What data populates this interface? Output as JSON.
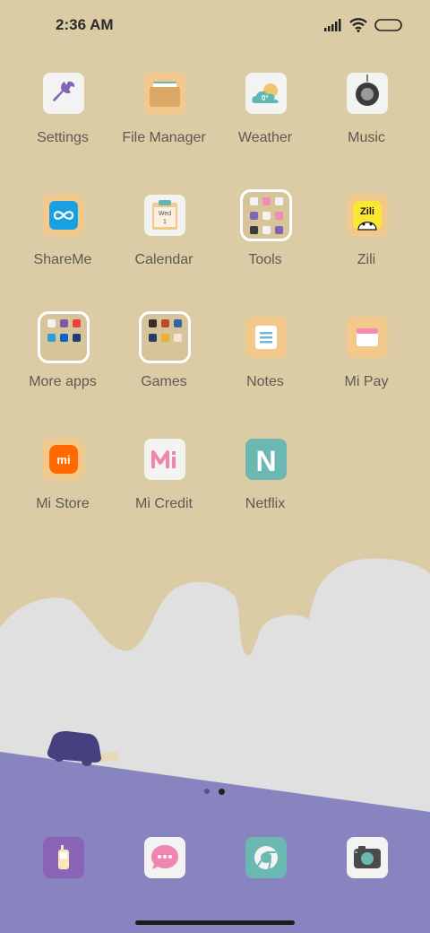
{
  "status_bar": {
    "time": "2:36 AM",
    "icons": [
      "signal-icon",
      "wifi-icon",
      "battery-icon"
    ]
  },
  "home_screen": {
    "apps": [
      {
        "label": "Settings",
        "icon": "wrench-icon"
      },
      {
        "label": "File Manager",
        "icon": "folder-icon"
      },
      {
        "label": "Weather",
        "icon": "cloud-sun-icon",
        "icon_text": "0°"
      },
      {
        "label": "Music",
        "icon": "speaker-icon"
      },
      {
        "label": "ShareMe",
        "icon": "infinity-icon"
      },
      {
        "label": "Calendar",
        "icon": "calendar-icon",
        "icon_day": "Wed",
        "icon_date": "1"
      },
      {
        "label": "Tools",
        "icon": "folder-icon"
      },
      {
        "label": "Zili",
        "icon": "zili-icon",
        "icon_text": "Zili"
      },
      {
        "label": "More apps",
        "icon": "folder-icon"
      },
      {
        "label": "Games",
        "icon": "folder-icon"
      },
      {
        "label": "Notes",
        "icon": "note-icon"
      },
      {
        "label": "Mi Pay",
        "icon": "wallet-icon"
      },
      {
        "label": "Mi Store",
        "icon": "mi-logo-icon",
        "icon_text": "mi"
      },
      {
        "label": "Mi Credit",
        "icon": "mi-credit-icon"
      },
      {
        "label": "Netflix",
        "icon": "netflix-icon",
        "icon_text": "N"
      }
    ]
  },
  "page_indicator": {
    "pages": 2,
    "current": 2
  },
  "dock": [
    {
      "name": "phone",
      "icon": "phone-icon"
    },
    {
      "name": "messages",
      "icon": "chat-bubble-icon"
    },
    {
      "name": "browser",
      "icon": "chrome-icon"
    },
    {
      "name": "camera",
      "icon": "camera-icon"
    }
  ],
  "colors": {
    "wallpaper_sand": "#DCCCA6",
    "wallpaper_cloud": "#E0E0E0",
    "wallpaper_hill": "#8784BF",
    "car": "#454181",
    "label_text": "#5d5a52"
  }
}
